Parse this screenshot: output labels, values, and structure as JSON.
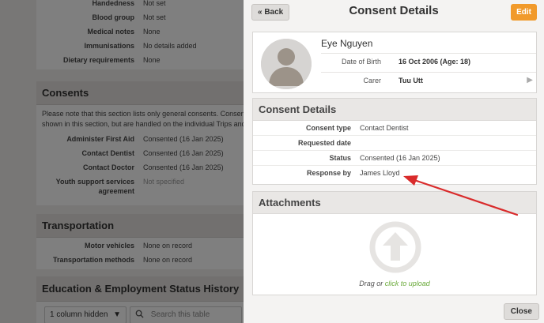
{
  "background": {
    "medical_rows": [
      {
        "label": "Handedness",
        "value": "Not set"
      },
      {
        "label": "Blood group",
        "value": "Not set"
      },
      {
        "label": "Medical notes",
        "value": "None"
      },
      {
        "label": "Immunisations",
        "value": "No details added"
      },
      {
        "label": "Dietary requirements",
        "value": "None"
      }
    ],
    "consents": {
      "title": "Consents",
      "note_line1": "Please note that this section lists only general consents. Consent",
      "note_line2": "shown in this section, but are handled on the individual Trips and",
      "rows": [
        {
          "label": "Administer First Aid",
          "value": "Consented (16 Jan 2025)"
        },
        {
          "label": "Contact Dentist",
          "value": "Consented (16 Jan 2025)"
        },
        {
          "label": "Contact Doctor",
          "value": "Consented (16 Jan 2025)"
        },
        {
          "label": "Youth support services agreement",
          "value": "Not specified"
        }
      ]
    },
    "transportation": {
      "title": "Transportation",
      "rows": [
        {
          "label": "Motor vehicles",
          "value": "None on record"
        },
        {
          "label": "Transportation methods",
          "value": "None on record"
        }
      ]
    },
    "education": {
      "title": "Education & Employment Status History"
    },
    "columns_hidden_label": "1 column hidden",
    "search_placeholder": "Search this table"
  },
  "modal": {
    "back_label": "« Back",
    "title": "Consent Details",
    "edit_label": "Edit",
    "profile": {
      "name": "Eye Nguyen",
      "dob_label": "Date of Birth",
      "dob_value": "16 Oct 2006 (Age: 18)",
      "carer_label": "Carer",
      "carer_value": "Tuu Utt"
    },
    "details": {
      "title": "Consent Details",
      "rows": [
        {
          "label": "Consent type",
          "value": "Contact Dentist"
        },
        {
          "label": "Requested date",
          "value": ""
        },
        {
          "label": "Status",
          "value": "Consented (16 Jan 2025)"
        },
        {
          "label": "Response by",
          "value": "James Lloyd"
        }
      ]
    },
    "attachments": {
      "title": "Attachments",
      "drag_text": "Drag or",
      "upload_link": "click to upload"
    },
    "close_label": "Close"
  },
  "colors": {
    "edit_button": "#f19a2b",
    "upload_link": "#6aaa3a",
    "annotation_arrow": "#d92b2b"
  },
  "icons": [
    "avatar-placeholder-icon",
    "chevron-right-icon",
    "upload-arrow-icon",
    "chevron-down-icon",
    "search-icon"
  ]
}
